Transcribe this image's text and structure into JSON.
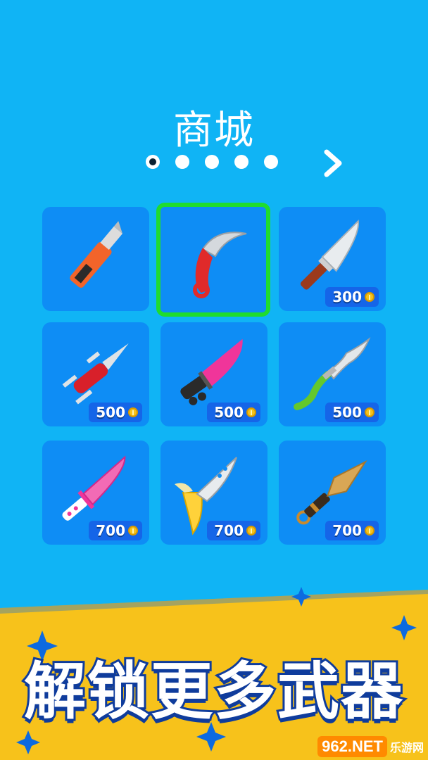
{
  "header": {
    "title": "商城"
  },
  "pager": {
    "page_count": 5,
    "current": 1,
    "next_icon": "chevron-right-icon"
  },
  "shop": {
    "items": [
      {
        "name": "utility-knife",
        "price": "",
        "selected": false
      },
      {
        "name": "karambit",
        "price": "",
        "selected": true
      },
      {
        "name": "chef-knife",
        "price": "300",
        "selected": false
      },
      {
        "name": "swiss-army-knife",
        "price": "500",
        "selected": false
      },
      {
        "name": "pink-combat-knife",
        "price": "500",
        "selected": false
      },
      {
        "name": "kris-dagger",
        "price": "500",
        "selected": false
      },
      {
        "name": "pink-heart-dagger",
        "price": "700",
        "selected": false
      },
      {
        "name": "banana-knife",
        "price": "700",
        "selected": false
      },
      {
        "name": "kunai",
        "price": "700",
        "selected": false
      }
    ],
    "currency_icon": "coin-icon"
  },
  "banner": {
    "text": "解锁更多武器"
  },
  "watermark": {
    "brand": "962.NET",
    "sub": "乐游网"
  },
  "colors": {
    "background": "#10b4f5",
    "slot": "#0e8df5",
    "selected_border": "#1fdc2e",
    "banner": "#f7c21b",
    "price_tag": "#1565e8"
  }
}
